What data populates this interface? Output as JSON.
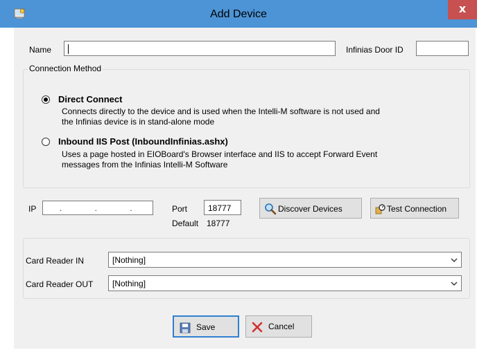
{
  "window": {
    "title": "Add Device",
    "close_label": "x"
  },
  "form": {
    "name_label": "Name",
    "name_value": "",
    "door_id_label": "Infinias Door ID",
    "door_id_value": ""
  },
  "connection": {
    "legend": "Connection Method",
    "options": [
      {
        "title": "Direct Connect",
        "selected": true,
        "desc_line1": "Connects directly to the device and is used when the Intelli-M software is not used and",
        "desc_line2": "the Infinias device is in stand-alone mode"
      },
      {
        "title": "Inbound IIS Post (InboundInfinias.ashx)",
        "selected": false,
        "desc_line1": "Uses a page hosted in EIOBoard's Browser interface and IIS to accept Forward Event",
        "desc_line2": "messages from the Infinias Intelli-M Software"
      }
    ]
  },
  "network": {
    "ip_label": "IP",
    "ip_value": ". . .",
    "port_label": "Port",
    "port_value": "18777",
    "default_label": "Default",
    "default_value": "18777",
    "discover_label": "Discover Devices",
    "test_label": "Test Connection"
  },
  "readers": {
    "in_label": "Card Reader IN",
    "in_value": "[Nothing]",
    "out_label": "Card Reader OUT",
    "out_value": "[Nothing]"
  },
  "actions": {
    "save_label": "Save",
    "cancel_label": "Cancel"
  },
  "colors": {
    "titlebar": "#4c94d6",
    "close": "#c75050",
    "client": "#f0f0f0"
  }
}
